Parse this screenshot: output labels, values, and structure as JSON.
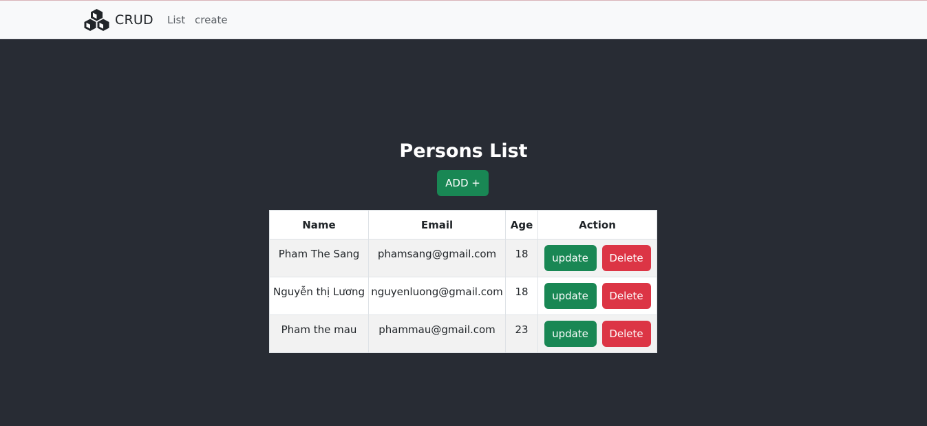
{
  "navbar": {
    "brand": "CRUD",
    "brand_icon": "boxes-icon",
    "links": [
      "List",
      "create"
    ]
  },
  "main": {
    "title": "Persons List",
    "add_button": "ADD +"
  },
  "table": {
    "headers": [
      "Name",
      "Email",
      "Age",
      "Action"
    ],
    "rows": [
      {
        "name": "Pham The Sang",
        "email": "phamsang@gmail.com",
        "age": "18",
        "update": "update",
        "delete": "Delete"
      },
      {
        "name": "Nguyễn thị Lương",
        "email": "nguyenluong@gmail.com",
        "age": "18",
        "update": "update",
        "delete": "Delete"
      },
      {
        "name": "Pham the mau",
        "email": "phammau@gmail.com",
        "age": "23",
        "update": "update",
        "delete": "Delete"
      }
    ]
  },
  "colors": {
    "background": "#282c34",
    "navbar": "#f8f9fa",
    "success": "#198754",
    "danger": "#dc3545"
  }
}
